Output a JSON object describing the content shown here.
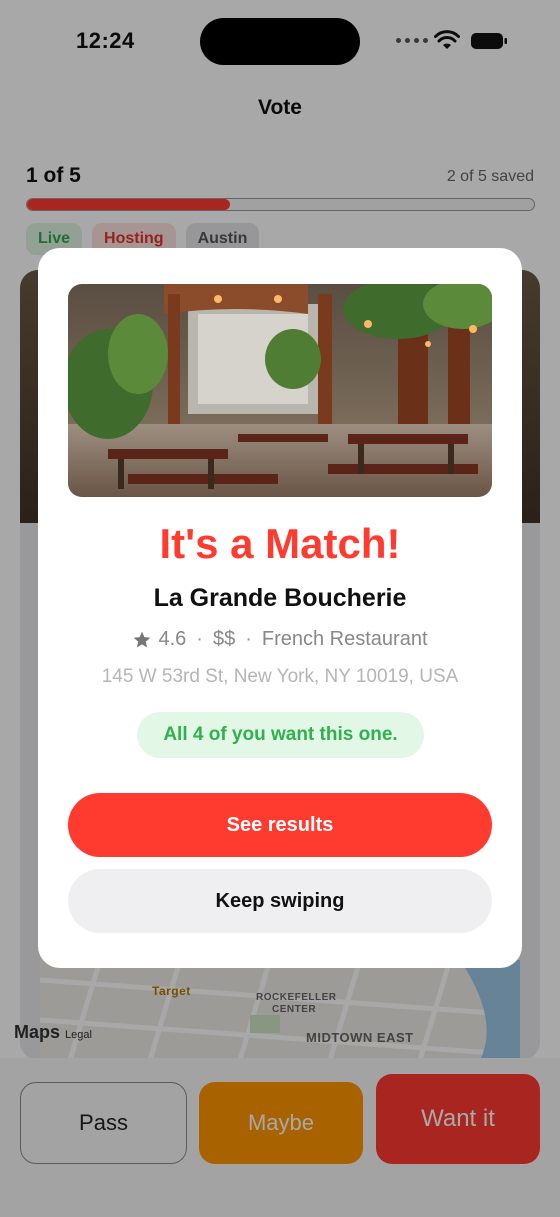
{
  "status": {
    "time": "12:24"
  },
  "nav": {
    "title": "Vote"
  },
  "progress": {
    "label": "1 of 5",
    "saved": "2 of 5 saved",
    "fraction": 0.4
  },
  "chips": [
    "Live",
    "Hosting",
    "Austin"
  ],
  "map": {
    "labels": [
      "Target",
      "ROCKEFELLER",
      "CENTER",
      "MIDTOWN EAST",
      "Maps",
      "Legal"
    ]
  },
  "actions": {
    "pass": "Pass",
    "maybe": "Maybe",
    "want": "Want it"
  },
  "modal": {
    "title": "It's a Match!",
    "name": "La Grande Boucherie",
    "rating": "4.6",
    "price": "$$",
    "category": "French Restaurant",
    "address": "145 W 53rd St, New York, NY 10019, USA",
    "consensus": "All 4 of you want this one.",
    "primary_button": "See results",
    "secondary_button": "Keep swiping"
  },
  "colors": {
    "accent": "#ff3b30",
    "success": "#2fb14f",
    "maybe": "#ff9500"
  },
  "icons": [
    "wifi-icon",
    "battery-icon",
    "star-icon"
  ]
}
